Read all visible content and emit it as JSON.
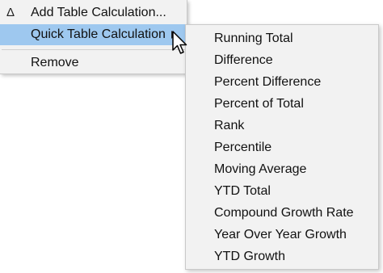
{
  "context_menu": {
    "add_table_calculation": "Add Table Calculation...",
    "quick_table_calculation": "Quick Table Calculation",
    "remove": "Remove"
  },
  "quick_table_submenu": {
    "items": [
      "Running Total",
      "Difference",
      "Percent Difference",
      "Percent of Total",
      "Rank",
      "Percentile",
      "Moving Average",
      "YTD Total",
      "Compound Growth Rate",
      "Year Over Year Growth",
      "YTD Growth"
    ]
  },
  "icons": {
    "delta": "Δ",
    "submenu_arrow": "triangle-right",
    "cursor": "arrow-pointer"
  },
  "colors": {
    "menu_background": "#f2f2f2",
    "highlight": "#9ec8ef",
    "border": "#c9c9c9",
    "text": "#111111"
  }
}
